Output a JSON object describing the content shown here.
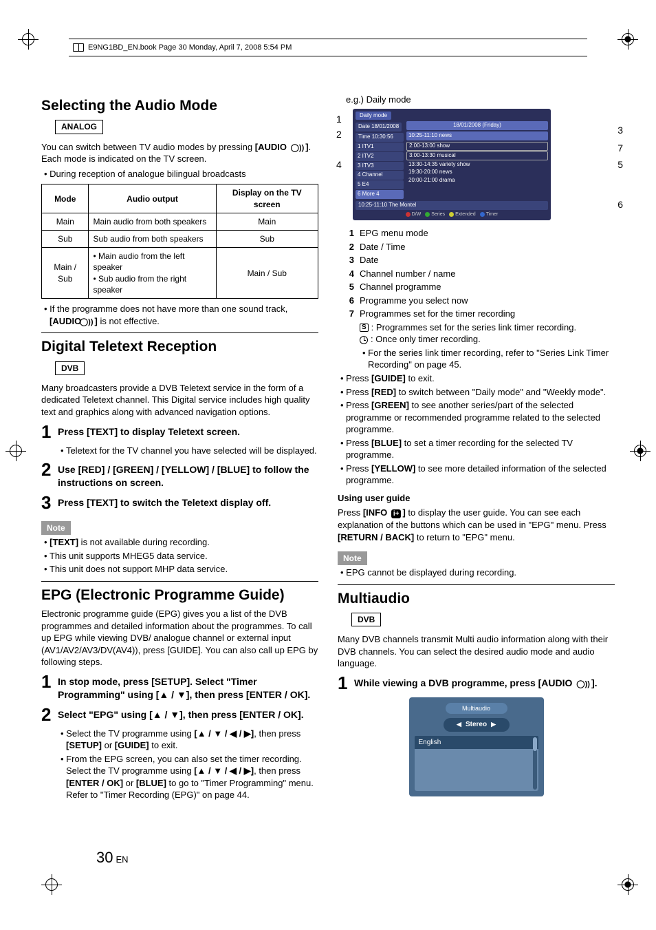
{
  "pagehead": "E9NG1BD_EN.book  Page 30  Monday, April 7, 2008  5:54 PM",
  "left": {
    "sec1": {
      "title": "Selecting the Audio Mode",
      "tag": "ANALOG",
      "intro1a": "You can switch between TV audio modes by pressing ",
      "intro1b": "[AUDIO ",
      "intro1c": "]",
      "intro1d": ". Each mode is indicated on the TV screen.",
      "bullet1": "During reception of analogue bilingual broadcasts",
      "table": {
        "h1": "Mode",
        "h2": "Audio output",
        "h3": "Display on the TV screen",
        "r1c1": "Main",
        "r1c2": "Main audio from both speakers",
        "r1c3": "Main",
        "r2c1": "Sub",
        "r2c2": "Sub audio from both speakers",
        "r2c3": "Sub",
        "r3c1": "Main / Sub",
        "r3c2a": "• Main audio from the left speaker",
        "r3c2b": "• Sub audio from the right speaker",
        "r3c3": "Main / Sub"
      },
      "after1a": "If the programme does not have more than one sound track, ",
      "after1b": "[AUDIO ",
      "after1c": "]",
      "after1d": " is not effective."
    },
    "sec2": {
      "title": "Digital Teletext Reception",
      "tag": "DVB",
      "intro": "Many broadcasters provide a DVB Teletext service in the form of a dedicated Teletext channel. This Digital service includes high quality text and graphics along with advanced navigation options.",
      "s1": "Press [TEXT] to display Teletext screen.",
      "s1b": "Teletext for the TV channel you have selected will be displayed.",
      "s2": "Use [RED] / [GREEN] / [YELLOW] / [BLUE] to follow the instructions on screen.",
      "s3": "Press [TEXT] to switch the Teletext display off.",
      "note": "Note",
      "n1a": "[TEXT]",
      "n1b": " is not available during recording.",
      "n2": "This unit supports MHEG5 data service.",
      "n3": "This unit does not support MHP data service."
    },
    "sec3": {
      "title": "EPG (Electronic Programme Guide)",
      "intro": "Electronic programme guide (EPG) gives you a list of the DVB programmes and detailed information about the programmes. To call up EPG while viewing DVB/ analogue channel or external input (AV1/AV2/AV3/DV(AV4)), press [GUIDE]. You can also call up EPG by following steps.",
      "s1": "In stop mode, press [SETUP]. Select \"Timer Programming\" using [▲ / ▼], then press [ENTER / OK].",
      "s2": "Select \"EPG\" using [▲ / ▼], then press [ENTER / OK].",
      "s2b1a": "Select the TV programme using ",
      "s2b1b": "[▲ / ▼ / ◀ / ▶]",
      "s2b1c": ", then press ",
      "s2b1d": "[SETUP]",
      "s2b1e": " or ",
      "s2b1f": "[GUIDE]",
      "s2b1g": " to exit.",
      "s2b2a": "From the EPG screen, you can also set the timer recording. Select the TV programme using ",
      "s2b2b": "[▲ / ▼ / ◀ / ▶]",
      "s2b2c": ", then press ",
      "s2b2d": "[ENTER / OK]",
      "s2b2e": " or ",
      "s2b2f": "[BLUE]",
      "s2b2g": " to go to \"Timer Programming\" menu. Refer to \"Timer Recording (EPG)\" on page 44."
    }
  },
  "right": {
    "eg": "e.g.) Daily mode",
    "epg": {
      "title": "Daily mode",
      "date": "Date   18/01/2008",
      "time": "Time   10:30:56",
      "dayhdr": "18/01/2008 (Friday)",
      "nowhdr": "10:25-11:10  news",
      "ch": [
        "1   ITV1",
        "2   ITV2",
        "3   ITV3",
        "4   Channel",
        "5   E4",
        "6   More 4"
      ],
      "progs": [
        "2:00-13:00   show",
        "3:00-13:30   musical",
        "13:30-14:35   variety show",
        "19:30-20:00   news",
        "20:00-21:00   drama"
      ],
      "footer": "10:25-11:10 The Montel",
      "btns": {
        "red": "D/W",
        "grn": "Series",
        "yel": "Extended",
        "blu": "Timer"
      }
    },
    "legend": {
      "l1": "EPG menu mode",
      "l2": "Date / Time",
      "l3": "Date",
      "l4": "Channel number / name",
      "l5": "Channel programme",
      "l6": "Programme you select now",
      "l7": "Programmes set for the timer recording",
      "l7a": "Programmes set for the series link timer recording.",
      "l7b": "Once only timer recording.",
      "l7c": "For the series link timer recording, refer to \"Series Link Timer Recording\" on page 45."
    },
    "b1a": "Press ",
    "b1b": "[GUIDE]",
    "b1c": " to exit.",
    "b2a": "Press ",
    "b2b": "[RED]",
    "b2c": " to switch between \"Daily mode\" and \"Weekly mode\".",
    "b3a": "Press ",
    "b3b": "[GREEN]",
    "b3c": " to see another series/part of the selected programme or recommended programme related to the selected programme.",
    "b4a": "Press ",
    "b4b": "[BLUE]",
    "b4c": " to set a timer recording for the selected TV programme.",
    "b5a": "Press ",
    "b5b": "[YELLOW]",
    "b5c": " to see more detailed information of the selected programme.",
    "ugh": "Using user guide",
    "ug1a": "Press ",
    "ug1b": "[INFO ",
    "ug1c": "]",
    "ug1d": " to display the user guide. You can see each explanation of the buttons which can be used in \"EPG\" menu. Press ",
    "ug1e": "[RETURN / BACK]",
    "ug1f": " to return to \"EPG\" menu.",
    "note": "Note",
    "n1": "EPG cannot be displayed during recording.",
    "sec2": {
      "title": "Multiaudio",
      "tag": "DVB",
      "intro": "Many DVB channels transmit Multi audio information along with their DVB channels. You can select the desired audio mode and audio language.",
      "s1a": "While viewing a DVB programme, press [AUDIO ",
      "s1b": "]."
    },
    "panel": {
      "tab": "Multiaudio",
      "sel": "Stereo",
      "item": "English"
    }
  },
  "pagenum": {
    "big": "30",
    "lang": "EN"
  }
}
